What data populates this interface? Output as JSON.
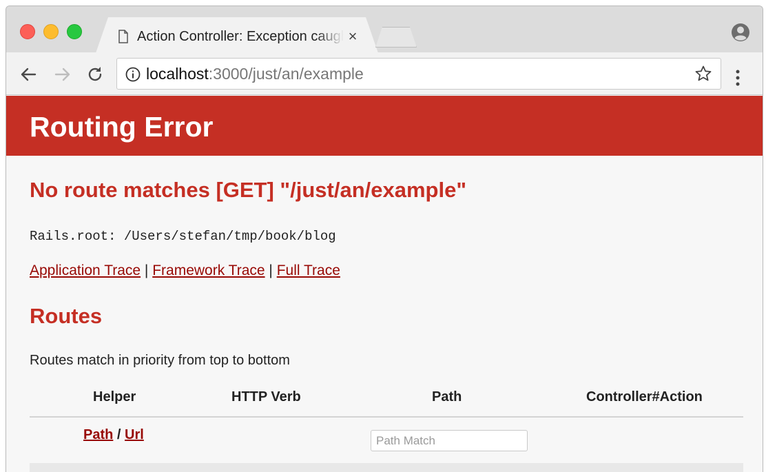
{
  "tab": {
    "title": "Action Controller: Exception caught",
    "close": "×"
  },
  "address_bar": {
    "host": "localhost",
    "path": ":3000/just/an/example"
  },
  "page": {
    "banner_title": "Routing Error",
    "error_title": "No route matches [GET] \"/just/an/example\"",
    "rails_root": "Rails.root: /Users/stefan/tmp/book/blog",
    "trace_links": [
      "Application Trace",
      "Framework Trace",
      "Full Trace"
    ],
    "trace_separator": " | ",
    "routes_title": "Routes",
    "routes_description": "Routes match in priority from top to bottom",
    "table": {
      "headers": [
        "Helper",
        "HTTP Verb",
        "Path",
        "Controller#Action"
      ],
      "helper_links": [
        "Path",
        "Url"
      ],
      "helper_separator": " / ",
      "path_placeholder": "Path Match"
    }
  },
  "icons": {
    "tab": "document-icon",
    "back": "back-arrow-icon",
    "forward": "forward-arrow-icon",
    "reload": "reload-icon",
    "info": "info-icon",
    "bookmark": "star-icon",
    "menu": "kebab-menu-icon",
    "profile": "profile-icon"
  },
  "colors": {
    "banner": "#c52f24",
    "heading": "#c52f24",
    "link": "#980905"
  }
}
